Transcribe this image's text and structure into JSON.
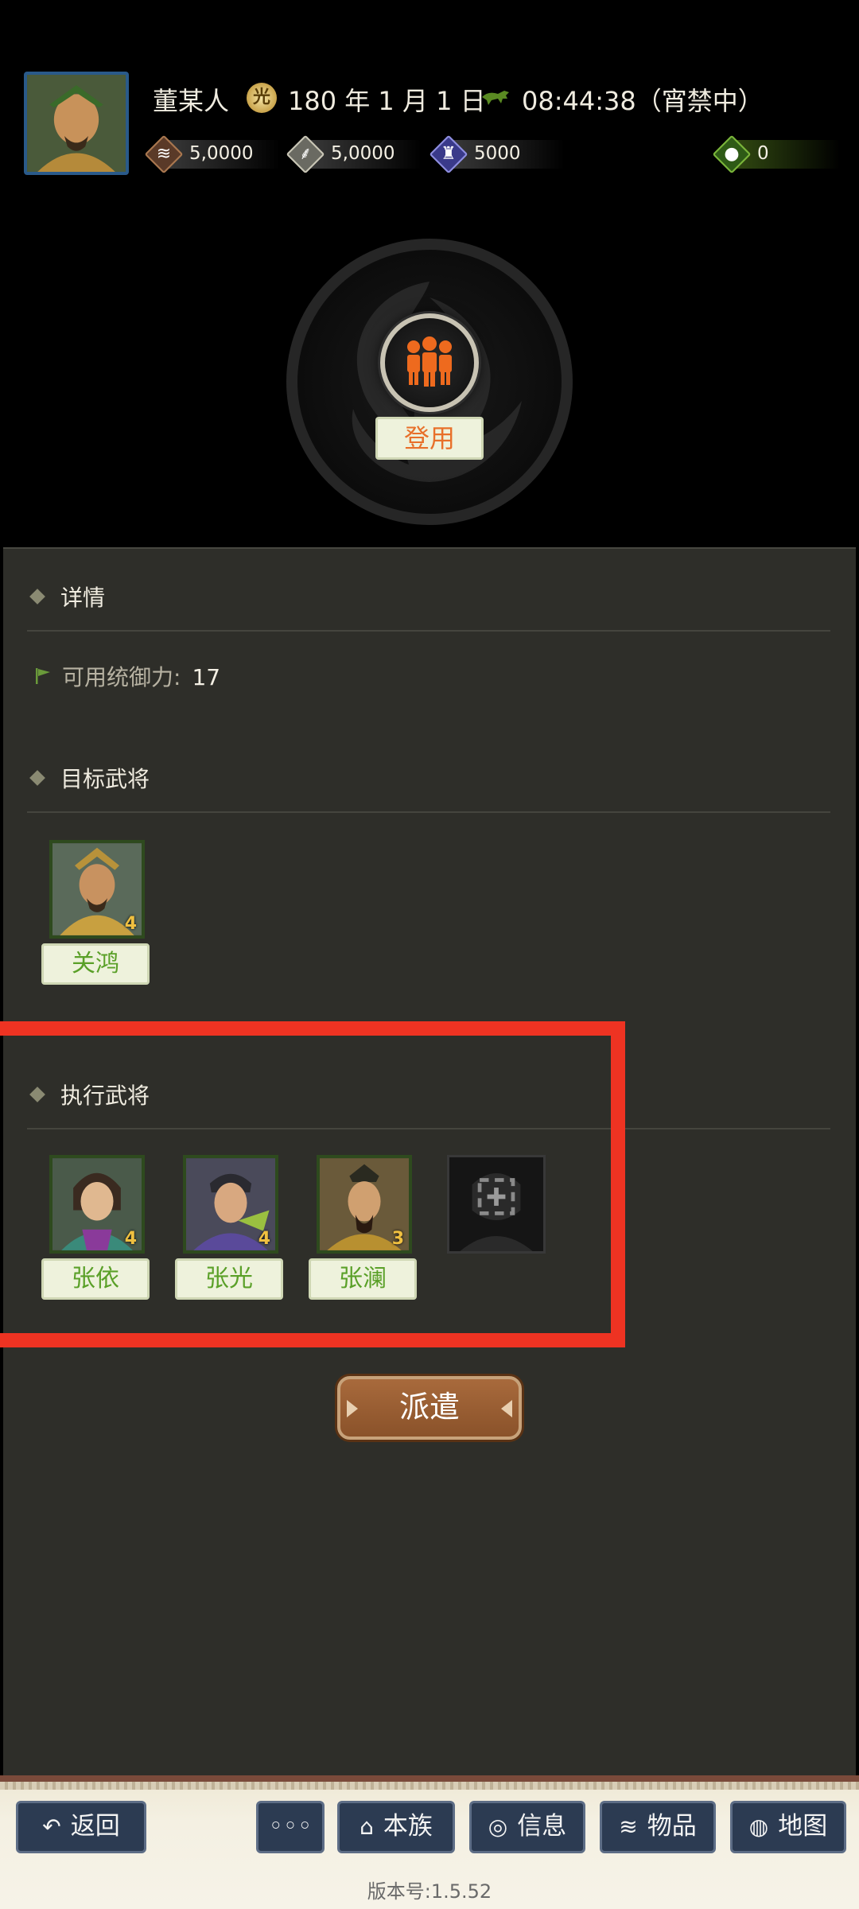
{
  "header": {
    "player_name": "董某人",
    "date_icon_glyph": "光",
    "date": "180 年 1 月 1 日",
    "time": "08:44:38（宵禁中）",
    "resources": [
      {
        "icon": "coin-icon",
        "glyph": "≋",
        "value": "5,0000",
        "color": "#5a3a28"
      },
      {
        "icon": "grain-icon",
        "glyph": "⸙",
        "value": "5,0000",
        "color": "#6a6a62"
      },
      {
        "icon": "troops-icon",
        "glyph": "♜",
        "value": "5000",
        "color": "#3a3a8a"
      },
      {
        "icon": "money-bag-icon",
        "glyph": "●",
        "value": "0",
        "color": "#2e5a16"
      }
    ]
  },
  "emblem": {
    "hire_label": "登用"
  },
  "details": {
    "title": "详情",
    "capacity_label": "可用统御力:",
    "capacity_value": "17"
  },
  "target": {
    "title": "目标武将",
    "generals": [
      {
        "name": "关鸿",
        "stars": "4"
      }
    ]
  },
  "executors": {
    "title": "执行武将",
    "generals": [
      {
        "name": "张依",
        "stars": "4"
      },
      {
        "name": "张光",
        "stars": "4"
      },
      {
        "name": "张澜",
        "stars": "3"
      }
    ]
  },
  "dispatch_label": "派遣",
  "nav": {
    "back": "返回",
    "more": "◦◦◦",
    "clan": "本族",
    "info": "信息",
    "items": "物品",
    "map": "地图"
  },
  "version": "版本号:1.5.52",
  "colors": {
    "accent_orange": "#e8702a",
    "name_green": "#5aa028",
    "highlight_red": "#ee3322",
    "nav_blue": "#2c3b52",
    "dispatch_brown": "#8a522a"
  }
}
